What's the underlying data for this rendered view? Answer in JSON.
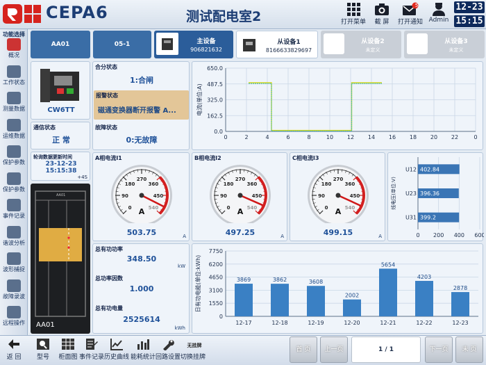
{
  "header": {
    "app_title": "CEPA6",
    "room_title": "测试配电室2",
    "buttons": [
      {
        "label": "打开菜单",
        "icon": "grid-menu-icon"
      },
      {
        "label": "截 屏",
        "icon": "camera-icon"
      },
      {
        "label": "打开通知",
        "icon": "envelope-icon",
        "badge": "5"
      },
      {
        "label": "Admin",
        "icon": "user-icon"
      }
    ],
    "date": "12-23",
    "time": "15:15"
  },
  "sidebar": {
    "title": "功能选择",
    "items": [
      {
        "label": "概况",
        "icon": "overview-icon"
      },
      {
        "label": "工作状态",
        "icon": "work-status-icon"
      },
      {
        "label": "测量数据",
        "icon": "measurement-icon"
      },
      {
        "label": "运维数据",
        "icon": "eye-icon"
      },
      {
        "label": "保护参数",
        "icon": "protect-a-icon"
      },
      {
        "label": "保护参数",
        "icon": "protect-b-icon"
      },
      {
        "label": "事件记录",
        "icon": "event-icon"
      },
      {
        "label": "谐波分析",
        "icon": "harmonic-icon"
      },
      {
        "label": "波形捕捉",
        "icon": "wave-icon"
      },
      {
        "label": "故障录波",
        "icon": "fault-wave-icon"
      },
      {
        "label": "远程操作",
        "icon": "remote-icon"
      }
    ]
  },
  "device_tabs": {
    "cabinet": "AA01",
    "loop": "05-1",
    "master": {
      "label": "主设备",
      "id": "906821632"
    },
    "slave1": {
      "label": "从设备1",
      "id": "8166633829697"
    },
    "slave2": {
      "label": "从设备2",
      "sub": "未定义"
    },
    "slave3": {
      "label": "从设备3",
      "sub": "未定义"
    }
  },
  "device": {
    "model": "CW6TT",
    "comm_label": "通信状态",
    "comm_value": "正 常",
    "poll_label": "轮询数据更新时间",
    "poll_date": "23-12-23",
    "poll_time": "15:15:38",
    "poll_interval": "+4S",
    "cabinet_name": "AA01"
  },
  "status": {
    "switch_label": "合分状态",
    "switch_value": "1:合闸",
    "alarm_label": "报警状态",
    "alarm_value": "磁通变换器断开报警 A...",
    "fault_label": "故障状态",
    "fault_value": "0:无故障"
  },
  "current_chart": {
    "ylabel": "电流(单位:A)",
    "yticks": [
      "650.0",
      "487.5",
      "325.0",
      "162.5",
      "0.0"
    ],
    "xticks": [
      "0",
      "2",
      "4",
      "6",
      "8",
      "10",
      "12",
      "14",
      "16",
      "18",
      "20",
      "22",
      "0"
    ]
  },
  "chart_data": [
    {
      "type": "line",
      "ylabel": "电流(单位:A)",
      "ylim": [
        0,
        650
      ],
      "xlim": [
        0,
        24
      ],
      "series": [
        {
          "color": "#d8d818",
          "x": [
            2.2,
            4.4,
            4.4,
            12.1,
            12.1,
            15
          ],
          "y": [
            500,
            500,
            10,
            10,
            500,
            500
          ]
        },
        {
          "color": "#30b8b8",
          "x": [
            2.2,
            4.4,
            4.4,
            12.1,
            12.1,
            15
          ],
          "y": [
            492,
            492,
            4,
            4,
            492,
            492
          ]
        }
      ]
    },
    {
      "type": "bar",
      "ylabel": "线电压(单位:V)",
      "orientation": "horizontal",
      "categories": [
        "U12",
        "U23",
        "U31"
      ],
      "values": [
        402.84,
        396.36,
        399.2
      ],
      "xlim": [
        0,
        600
      ],
      "xticks": [
        "0",
        "200",
        "400",
        "600"
      ]
    },
    {
      "type": "bar",
      "ylabel": "日有功电能(单位:kWh)",
      "categories": [
        "12-17",
        "12-18",
        "12-19",
        "12-20",
        "12-21",
        "12-22",
        "12-23"
      ],
      "values": [
        3869,
        3862,
        3608,
        2002,
        5654,
        4203,
        2878
      ],
      "ylim": [
        0,
        7750
      ],
      "yticks": [
        "7750",
        "6200",
        "4650",
        "3100",
        "1550",
        "0"
      ]
    }
  ],
  "gauges": [
    {
      "title": "A相电流I1",
      "value": 503.75,
      "display": "503.75",
      "unit": "A"
    },
    {
      "title": "B相电流I2",
      "value": 497.25,
      "display": "497.25",
      "unit": "A"
    },
    {
      "title": "C相电流I3",
      "value": 499.15,
      "display": "499.15",
      "unit": "A"
    }
  ],
  "gauge_scale": {
    "ticks": [
      "0",
      "90",
      "180",
      "270",
      "360",
      "450",
      "540"
    ],
    "unit_big": "A"
  },
  "power": {
    "active_label": "总有功功率",
    "active_value": "348.50",
    "active_unit": "kW",
    "pf_label": "总功率因数",
    "pf_value": "1.000",
    "energy_label": "总有功电量",
    "energy_value": "2525614",
    "energy_unit": "kWh"
  },
  "footer": {
    "items": [
      {
        "label": "返 回",
        "icon": "back-arrow-icon"
      },
      {
        "label": "型号",
        "icon": "search-model-icon"
      },
      {
        "label": "柜面图",
        "icon": "cabinet-grid-icon"
      },
      {
        "label": "事件记录",
        "icon": "event-log-icon"
      },
      {
        "label": "历史曲线",
        "icon": "history-curve-icon"
      },
      {
        "label": "能耗统计",
        "icon": "energy-stat-icon"
      },
      {
        "label": "回路设置",
        "icon": "wrench-icon"
      },
      {
        "label": "切换挂牌",
        "icon": "tag-switch-icon",
        "top": "无挂牌"
      }
    ],
    "first": "首 页",
    "prev": "上一页",
    "page": "1 / 1",
    "next": "下一页",
    "last": "末 页"
  }
}
